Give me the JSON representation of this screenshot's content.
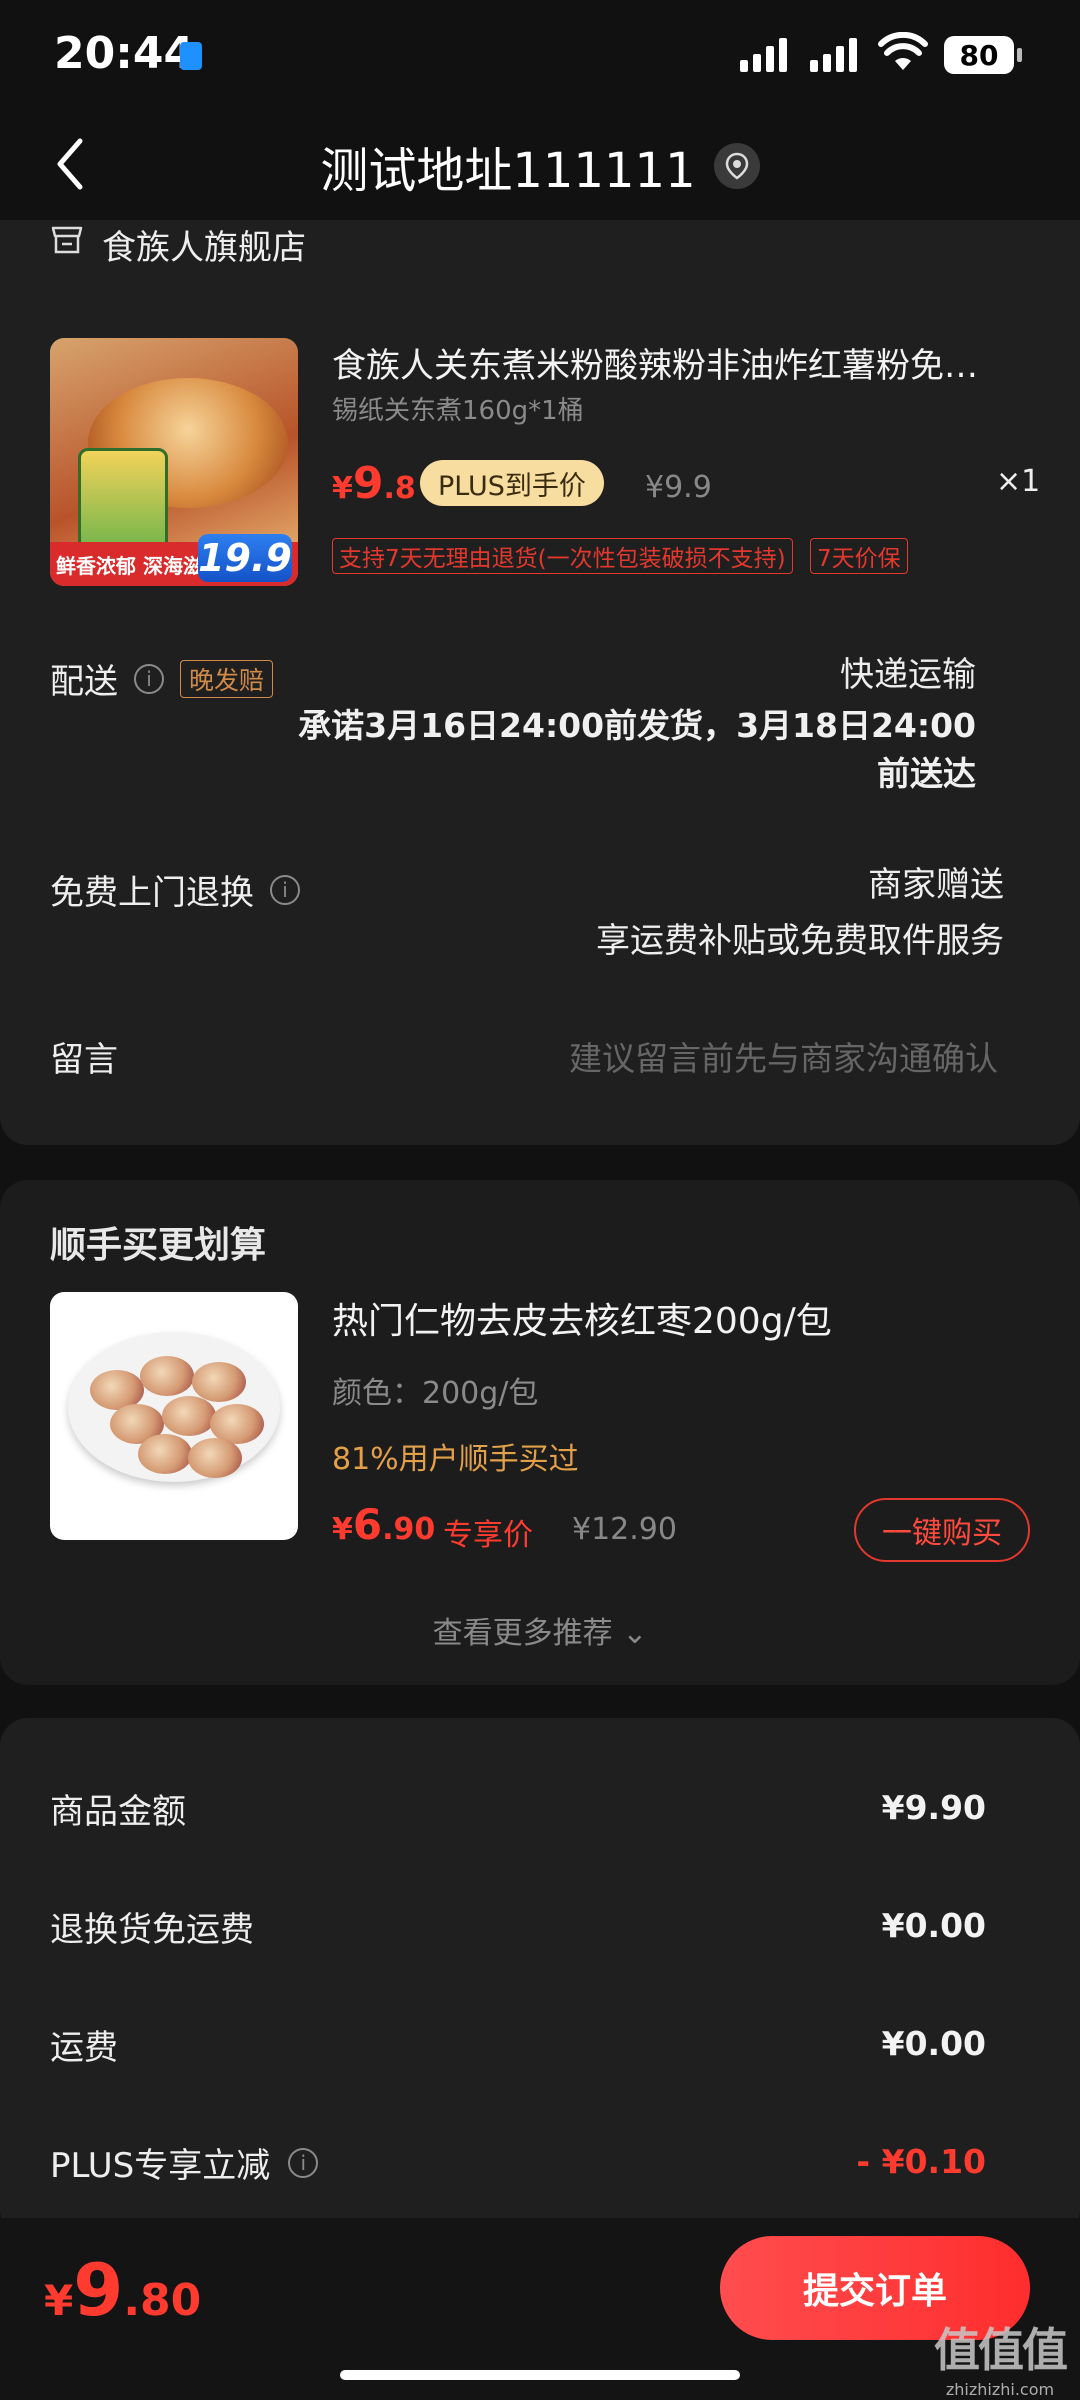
{
  "status_bar": {
    "time": "20:44",
    "battery": "80"
  },
  "header": {
    "title": "测试地址111111"
  },
  "order": {
    "store_name": "食族人旗舰店",
    "product": {
      "image_banner": "鲜香浓郁 深海滋味",
      "image_price": "19.9",
      "title": "食族人关东煮米粉酸辣粉非油炸红薯粉免…",
      "spec": "锡纸关东煮160g*1桶",
      "price_yen": "¥",
      "price_int": "9",
      "price_dec": ".8",
      "plus_badge": "PLUS到手价",
      "original_price": "¥9.9",
      "quantity": "×1",
      "tags": [
        "支持7天无理由退货(一次性包装破损不支持)",
        "7天价保"
      ]
    },
    "delivery": {
      "label": "配送",
      "badge": "晚发赔",
      "method": "快递运输",
      "promise": "承诺3月16日24:00前发货，3月18日24:00前送达"
    },
    "free_return": {
      "label": "免费上门退换",
      "line1": "商家赠送",
      "line2": "享运费补贴或免费取件服务"
    },
    "message": {
      "label": "留言",
      "placeholder": "建议留言前先与商家沟通确认"
    }
  },
  "recommend": {
    "title": "顺手买更划算",
    "item": {
      "name": "热门仁物去皮去核红枣200g/包",
      "spec": "颜色：200g/包",
      "bought": "81%用户顺手买过",
      "price_yen": "¥",
      "price_int": "6",
      "price_dec": ".90",
      "exclusive": "专享价",
      "original_price": "¥12.90",
      "buy_label": "一键购买"
    },
    "more": "查看更多推荐 ⌄"
  },
  "summary": {
    "rows": [
      {
        "label": "商品金额",
        "value": "¥9.90"
      },
      {
        "label": "退换货免运费",
        "value": "¥0.00"
      },
      {
        "label": "运费",
        "value": "¥0.00"
      },
      {
        "label": "PLUS专享立减",
        "value": "- ¥0.10"
      }
    ]
  },
  "bottom": {
    "total_yen": "¥",
    "total_int": "9",
    "total_dec": ".80",
    "submit_label": "提交订单",
    "watermark": "值值值",
    "watermark_url": "zhizhizhi.com"
  },
  "colors": {
    "accent_red": "#ff3b30",
    "plus_gold": "#f8dda0",
    "background": "#111111",
    "card": "#1f1f1f"
  },
  "icons": [
    "back-icon",
    "location-icon",
    "store-icon",
    "info-icon",
    "signal-icon",
    "wifi-icon",
    "battery-icon"
  ]
}
